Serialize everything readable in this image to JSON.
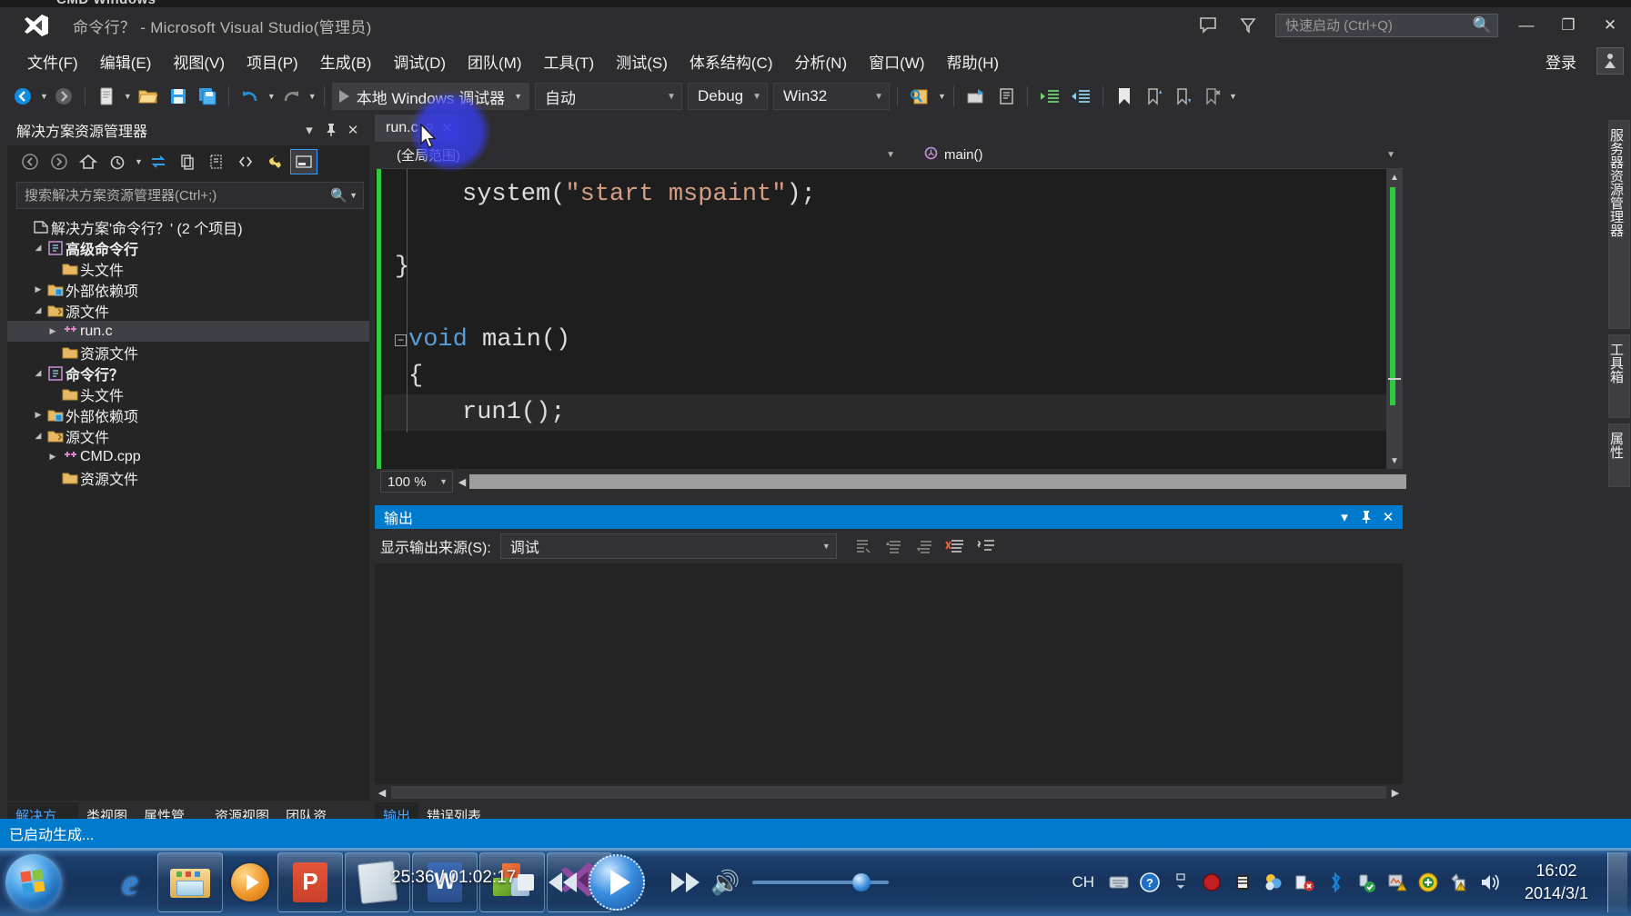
{
  "bleed": {
    "behind_window_title": "CMD Windows"
  },
  "titlebar": {
    "title": "命令行？ - Microsoft Visual Studio(管理员)",
    "quick_launch_placeholder": "快速启动 (Ctrl+Q)",
    "minimize": "—",
    "maximize": "❐",
    "close": "✕"
  },
  "menubar": {
    "items": [
      {
        "label": "文件(F)"
      },
      {
        "label": "编辑(E)"
      },
      {
        "label": "视图(V)"
      },
      {
        "label": "项目(P)"
      },
      {
        "label": "生成(B)"
      },
      {
        "label": "调试(D)"
      },
      {
        "label": "团队(M)"
      },
      {
        "label": "工具(T)"
      },
      {
        "label": "测试(S)"
      },
      {
        "label": "体系结构(C)"
      },
      {
        "label": "分析(N)"
      },
      {
        "label": "窗口(W)"
      },
      {
        "label": "帮助(H)"
      }
    ],
    "signin": "登录"
  },
  "toolbar": {
    "start_debug": "本地 Windows 调试器",
    "config_value": "自动",
    "solution_config": "Debug",
    "solution_platform": "Win32"
  },
  "solution_explorer": {
    "title": "解决方案资源管理器",
    "search_placeholder": "搜索解决方案资源管理器(Ctrl+;)",
    "tree": [
      {
        "label": "解决方案'命令行？' (2 个项目)",
        "indent": 0,
        "expander": "",
        "icon": "solution-icon",
        "selected": false
      },
      {
        "label": "高级命令行",
        "indent": 1,
        "expander": "▲",
        "icon": "project-icon",
        "selected": false
      },
      {
        "label": "头文件",
        "indent": 2,
        "expander": "",
        "icon": "folder-icon",
        "selected": false
      },
      {
        "label": "外部依赖项",
        "indent": 2,
        "expander": "▶",
        "icon": "folder-ext-icon",
        "selected": false
      },
      {
        "label": "源文件",
        "indent": 2,
        "expander": "▲",
        "icon": "folder-open-icon",
        "selected": false
      },
      {
        "label": "run.c",
        "indent": 3,
        "expander": "▶",
        "icon": "cpp-file-icon",
        "selected": true
      },
      {
        "label": "资源文件",
        "indent": 2,
        "expander": "",
        "icon": "folder-icon",
        "selected": false
      },
      {
        "label": "命令行？",
        "indent": 1,
        "expander": "▲",
        "icon": "project-icon",
        "selected": false
      },
      {
        "label": "头文件",
        "indent": 2,
        "expander": "",
        "icon": "folder-icon",
        "selected": false
      },
      {
        "label": "外部依赖项",
        "indent": 2,
        "expander": "▶",
        "icon": "folder-ext-icon",
        "selected": false
      },
      {
        "label": "源文件",
        "indent": 2,
        "expander": "▲",
        "icon": "folder-open-icon",
        "selected": false
      },
      {
        "label": "CMD.cpp",
        "indent": 3,
        "expander": "▶",
        "icon": "cpp-file-icon",
        "selected": false
      },
      {
        "label": "资源文件",
        "indent": 2,
        "expander": "",
        "icon": "folder-icon",
        "selected": false
      }
    ]
  },
  "editor": {
    "tab_label": "run.c",
    "scope_dropdown": "(全局范围)",
    "member_dropdown": "main()",
    "zoom_level": "100 %",
    "code_lines": [
      {
        "indent": 3,
        "segments": [
          {
            "t": "system(",
            "c": "plain"
          },
          {
            "t": "\"start mspaint\"",
            "c": "string"
          },
          {
            "t": ");",
            "c": "plain"
          }
        ],
        "highlight": false,
        "fold": false
      },
      {
        "indent": 0,
        "segments": [],
        "highlight": false,
        "fold": false
      },
      {
        "indent": 0,
        "segments": [
          {
            "t": "}",
            "c": "plain"
          }
        ],
        "highlight": false,
        "fold": false
      },
      {
        "indent": 0,
        "segments": [],
        "highlight": false,
        "fold": false
      },
      {
        "indent": 0,
        "segments": [
          {
            "t": "void",
            "c": "keyword"
          },
          {
            "t": " main()",
            "c": "plain"
          }
        ],
        "highlight": false,
        "fold": true
      },
      {
        "indent": 0,
        "segments": [
          {
            "t": "{",
            "c": "plain"
          }
        ],
        "highlight": false,
        "fold": false
      },
      {
        "indent": 3,
        "segments": [
          {
            "t": "run1();",
            "c": "plain"
          }
        ],
        "highlight": true,
        "fold": false
      }
    ]
  },
  "output_panel": {
    "title": "输出",
    "source_label": "显示输出来源(S):",
    "source_value": "调试",
    "content": ""
  },
  "bottom_tabs_left": [
    {
      "label": "解决方…",
      "active": true
    },
    {
      "label": "类视图",
      "active": false
    },
    {
      "label": "属性管…",
      "active": false
    },
    {
      "label": "资源视图",
      "active": false
    },
    {
      "label": "团队资…",
      "active": false
    }
  ],
  "bottom_tabs_right": [
    {
      "label": "输出",
      "active": true
    },
    {
      "label": "错误列表",
      "active": false
    }
  ],
  "vertical_tabs": [
    {
      "label": "服务器资源管理器"
    },
    {
      "label": "工具箱"
    },
    {
      "label": "属性"
    }
  ],
  "statusbar": {
    "text": "已启动生成..."
  },
  "taskbar": {
    "items": [
      {
        "name": "internet-explorer",
        "label": "Internet Explorer"
      },
      {
        "name": "file-explorer",
        "label": "文件资源管理器"
      },
      {
        "name": "windows-media-player",
        "label": "Windows Media Player"
      },
      {
        "name": "powerpoint",
        "label": "PowerPoint"
      },
      {
        "name": "notepad",
        "label": "记事本"
      },
      {
        "name": "word",
        "label": "Word"
      },
      {
        "name": "office-tools",
        "label": "Office"
      },
      {
        "name": "visual-studio",
        "label": "Visual Studio"
      }
    ],
    "media_time": "25:36 / 01:02:17",
    "tray": {
      "ime": "CH",
      "clock_time": "16:02",
      "clock_date": "2014/3/1"
    }
  },
  "colors": {
    "accent_blue": "#007acc",
    "window_bg": "#2d2d30",
    "panel_bg": "#252526",
    "editor_bg": "#1e1e1e",
    "string_color": "#d69d85",
    "keyword_color": "#569cd6",
    "change_green": "#2ecc3f"
  }
}
